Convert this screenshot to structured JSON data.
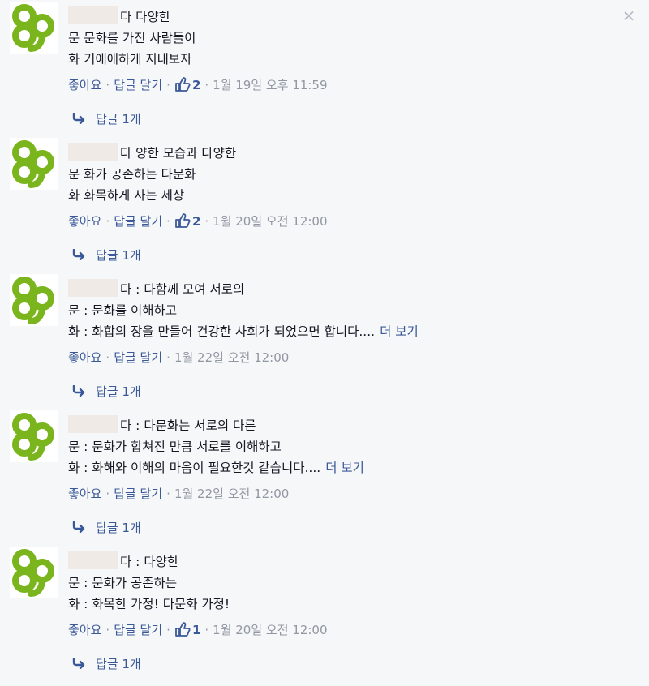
{
  "comments": [
    {
      "lines": [
        "다 다양한",
        "문 문화를 가진 사람들이",
        "화 기애애하게 지내보자"
      ],
      "more_label": "",
      "actions": {
        "like": "좋아요",
        "reply": "답글 달기",
        "like_count": "2",
        "timestamp": "1월 19일 오후 11:59"
      },
      "replies_label": "답글 1개"
    },
    {
      "lines": [
        "다 양한 모습과 다양한",
        "문 화가 공존하는 다문화",
        "화 화목하게 사는 세상"
      ],
      "more_label": "",
      "actions": {
        "like": "좋아요",
        "reply": "답글 달기",
        "like_count": "2",
        "timestamp": "1월 20일 오전 12:00"
      },
      "replies_label": "답글 1개"
    },
    {
      "lines": [
        "다 : 다함께 모여 서로의",
        "문 : 문화를 이해하고",
        "화 : 화합의 장을 만들어 건강한 사회가 되었으면 합니다...."
      ],
      "more_label": "더 보기",
      "actions": {
        "like": "좋아요",
        "reply": "답글 달기",
        "like_count": "",
        "timestamp": "1월 22일 오전 12:00"
      },
      "replies_label": "답글 1개"
    },
    {
      "lines": [
        "다 : 다문화는 서로의 다른",
        "문 : 문화가 합쳐진 만큼 서로를 이해하고",
        "화 : 화해와 이해의 마음이 필요한것 같습니다...."
      ],
      "more_label": "더 보기",
      "actions": {
        "like": "좋아요",
        "reply": "답글 달기",
        "like_count": "",
        "timestamp": "1월 22일 오전 12:00"
      },
      "replies_label": "답글 1개"
    },
    {
      "lines": [
        "다 : 다양한",
        "문 : 문화가 공존하는",
        "화 : 화목한 가정! 다문화 가정!"
      ],
      "more_label": "",
      "actions": {
        "like": "좋아요",
        "reply": "답글 달기",
        "like_count": "1",
        "timestamp": "1월 20일 오전 12:00"
      },
      "replies_label": "답글 1개"
    }
  ],
  "close_label": "×",
  "colors": {
    "link": "#3b5998",
    "meta": "#9197a3",
    "text": "#141823",
    "logo": "#7ab51d",
    "background": "#f6f7f9"
  },
  "icons": {
    "avatar": "green-clover-logo",
    "like": "thumbs-up-icon",
    "reply": "reply-arrow-icon",
    "close": "close-icon"
  }
}
